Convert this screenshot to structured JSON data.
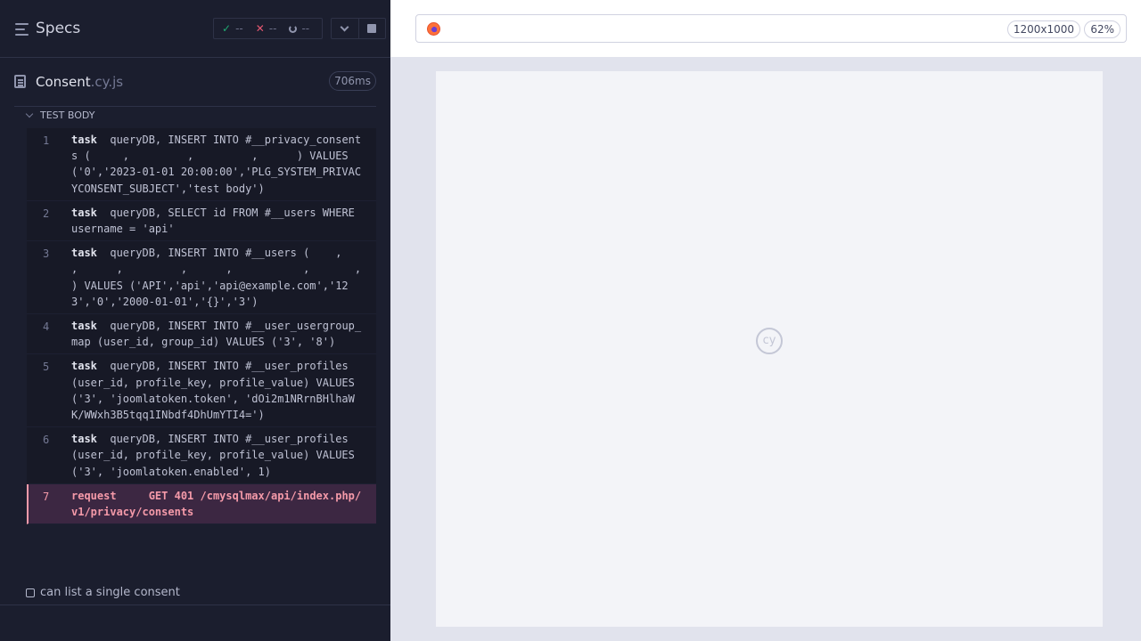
{
  "header": {
    "title": "Specs",
    "stats": {
      "passed": "--",
      "failed": "--",
      "pending": "--"
    }
  },
  "spec": {
    "name": "Consent",
    "ext": ".cy.js",
    "duration": "706ms"
  },
  "section": {
    "label": "TEST BODY"
  },
  "commands": [
    {
      "num": "1",
      "name": "task",
      "message": "queryDB, INSERT INTO #__privacy_consents (     ,         ,         ,      ) VALUES ('0','2023-01-01 20:00:00','PLG_SYSTEM_PRIVACYCONSENT_SUBJECT','test body')"
    },
    {
      "num": "2",
      "name": "task",
      "message": "queryDB, SELECT id FROM #__users WHERE username = 'api'"
    },
    {
      "num": "3",
      "name": "task",
      "message": "queryDB, INSERT INTO #__users (    ,         ,      ,         ,      ,           ,       ,   ) VALUES ('API','api','api@example.com','123','0','2000-01-01','{}','3')"
    },
    {
      "num": "4",
      "name": "task",
      "message": "queryDB, INSERT INTO #__user_usergroup_map (user_id, group_id) VALUES ('3', '8')"
    },
    {
      "num": "5",
      "name": "task",
      "message": "queryDB, INSERT INTO #__user_profiles (user_id, profile_key, profile_value) VALUES ('3', 'joomlatoken.token', 'dOi2m1NRrnBHlhaWK/WWxh3B5tqq1INbdf4DhUmYTI4=')"
    },
    {
      "num": "6",
      "name": "task",
      "message": "queryDB, INSERT INTO #__user_profiles (user_id, profile_key, profile_value) VALUES ('3', 'joomlatoken.enabled', 1)"
    },
    {
      "num": "7",
      "name": "request",
      "message": "   GET 401 /cmysqlmax/api/index.php/v1/privacy/consents"
    }
  ],
  "next_test": {
    "label": "can list a single consent"
  },
  "browser": {
    "viewport": "1200x1000",
    "zoom": "62%",
    "logo_text": "cy"
  },
  "colors": {
    "panel_bg": "#1b1e2e",
    "pass": "#1fa971",
    "fail": "#e45770",
    "error_row_bg": "#3c2742",
    "error_text": "#f59aa9"
  }
}
